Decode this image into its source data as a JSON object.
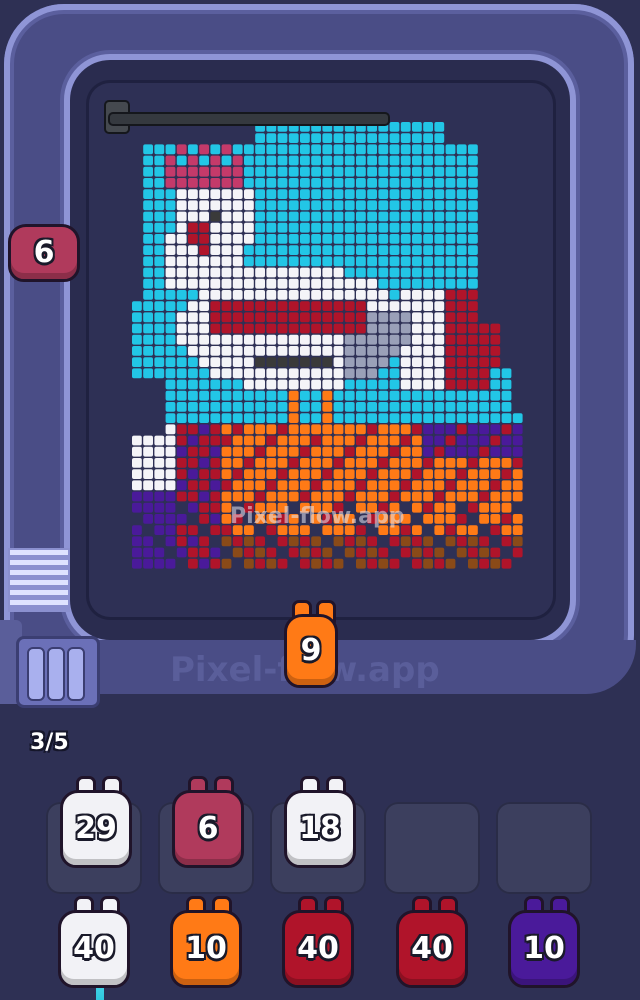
{
  "watermark": "Pixel-flow.app",
  "progress": "3/5",
  "colors": {
    "background": "#2e3054",
    "track": "#4a4d86",
    "cyan": "#22c6e6",
    "white": "#f4f4f8",
    "red": "#b0142a",
    "orange": "#ff7a16",
    "purple": "#4a1a9a"
  },
  "track_shooter": {
    "value": "6",
    "color": "#b03a5c"
  },
  "active_shooter": {
    "value": "9",
    "color": "#ff7a16"
  },
  "queue_slots": [
    {
      "value": "29",
      "color": "#f2f2f6"
    },
    {
      "value": "6",
      "color": "#b03a5c"
    },
    {
      "value": "18",
      "color": "#f2f2f6"
    },
    {
      "value": "",
      "color": ""
    },
    {
      "value": "",
      "color": ""
    }
  ],
  "reserve": [
    {
      "value": "40",
      "color": "#f2f2f6"
    },
    {
      "value": "10",
      "color": "#ff7a16"
    },
    {
      "value": "40",
      "color": "#b0142a"
    },
    {
      "value": "40",
      "color": "#b0142a"
    },
    {
      "value": "10",
      "color": "#4a1a9a"
    }
  ]
}
